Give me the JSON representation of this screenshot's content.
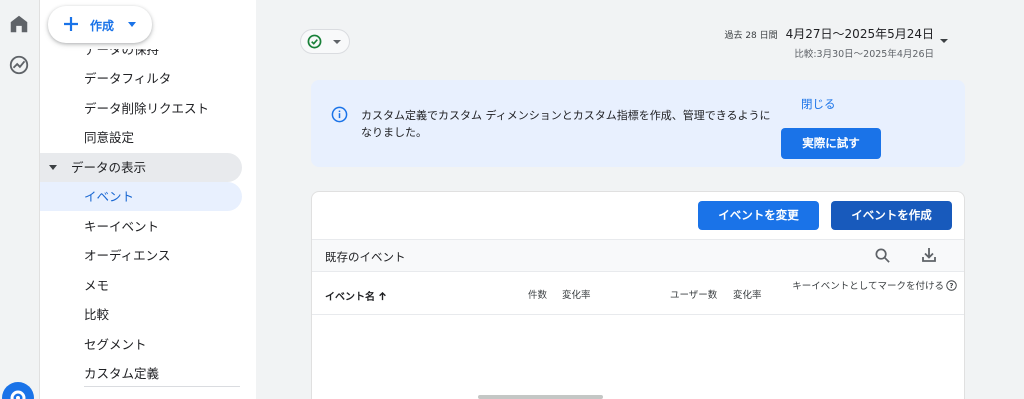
{
  "rail": {
    "icons": [
      "home-icon",
      "reports-icon",
      "settings-icon"
    ]
  },
  "create": {
    "label": "作成"
  },
  "sidebar": {
    "items": [
      {
        "label": "データの保持"
      },
      {
        "label": "データフィルタ"
      },
      {
        "label": "データ削除リクエスト"
      },
      {
        "label": "同意設定"
      },
      {
        "label": "データの表示"
      },
      {
        "label": "イベント"
      },
      {
        "label": "キーイベント"
      },
      {
        "label": "オーディエンス"
      },
      {
        "label": "メモ"
      },
      {
        "label": "比較"
      },
      {
        "label": "セグメント"
      },
      {
        "label": "カスタム定義"
      }
    ]
  },
  "header": {
    "date_prefix": "過去 28 日間",
    "date_range": "4月27日～2025年5月24日",
    "compare_range": "比較:3月30日～2025年4月26日"
  },
  "banner": {
    "text": "カスタム定義でカスタム ディメンションとカスタム指標を作成、管理できるようになりました。",
    "close_label": "閉じる",
    "try_label": "実際に試す"
  },
  "table": {
    "modify_button": "イベントを変更",
    "create_button": "イベントを作成",
    "title": "既存のイベント",
    "columns": {
      "name": "イベント名",
      "count": "件数",
      "change1": "変化率",
      "users": "ユーザー数",
      "change2": "変化率",
      "keyevent": "キーイベントとしてマークを付ける"
    }
  },
  "colors": {
    "accent": "#1a73e8",
    "accent_dark": "#185abc",
    "banner_bg": "#e8f0fe",
    "status_green": "#188038"
  }
}
